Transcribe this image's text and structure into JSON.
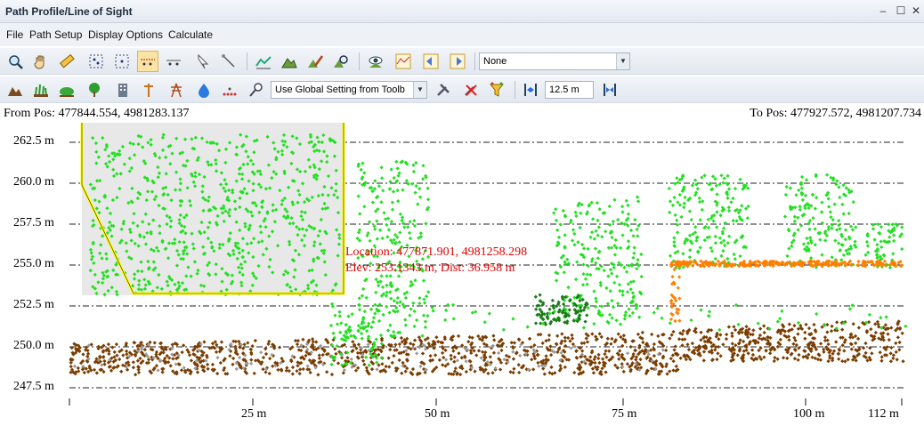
{
  "window": {
    "title": "Path Profile/Line of Sight",
    "min": "–",
    "max": "☐",
    "close": "✕"
  },
  "menu": {
    "file": "File",
    "path_setup": "Path Setup",
    "display_options": "Display Options",
    "calculate": "Calculate"
  },
  "toolbar1": {
    "icons": [
      "zoom-icon",
      "pan-hand-icon",
      "ruler-icon",
      "select-points-icon",
      "select-region-icon",
      "profile-active-icon",
      "profile-alt-icon",
      "arrow-select-icon",
      "line-select-icon",
      "terrain-profile-icon",
      "mountain-icon",
      "edit-profile-icon",
      "analyze-icon",
      "view-eye-icon",
      "graph-icon",
      "swap-left-icon",
      "swap-right-icon"
    ],
    "dropdown_value": "None"
  },
  "toolbar2": {
    "icons": [
      "terrain-icon",
      "grass-icon",
      "shrub-icon",
      "tree-icon",
      "building-icon",
      "tower-icon",
      "power-line-icon",
      "water-icon",
      "points-icon",
      "marker-icon"
    ],
    "setting_dropdown": "Use Global Setting from Toolb",
    "icons_after": [
      "tools-icon",
      "clear-icon",
      "filter-icon",
      "width-narrow-icon"
    ],
    "width_value": "12.5 m",
    "width_wide_icon": "width-wide-icon"
  },
  "profile": {
    "from_pos": "From Pos: 477844.554, 4981283.137",
    "to_pos": "To Pos: 477927.572, 4981207.734",
    "location_label": "Location: 477871.901, 4981258.298",
    "elev_label": "Elev: 253.1343 m, Dist: 36.958 m",
    "y_ticks": [
      "262.5 m",
      "260.0 m",
      "257.5 m",
      "255.0 m",
      "252.5 m",
      "250.0 m",
      "247.5 m"
    ],
    "x_ticks": [
      "25 m",
      "50 m",
      "75 m",
      "100 m",
      "112 m"
    ],
    "colors": {
      "ground": "#7a3d00",
      "vegetation": "#22e022",
      "dark_veg": "#1a7a1a",
      "building": "#ff7f00",
      "gray": "#9a9a9a",
      "highlight": "#ffff00",
      "annotation": "#e00000"
    }
  }
}
